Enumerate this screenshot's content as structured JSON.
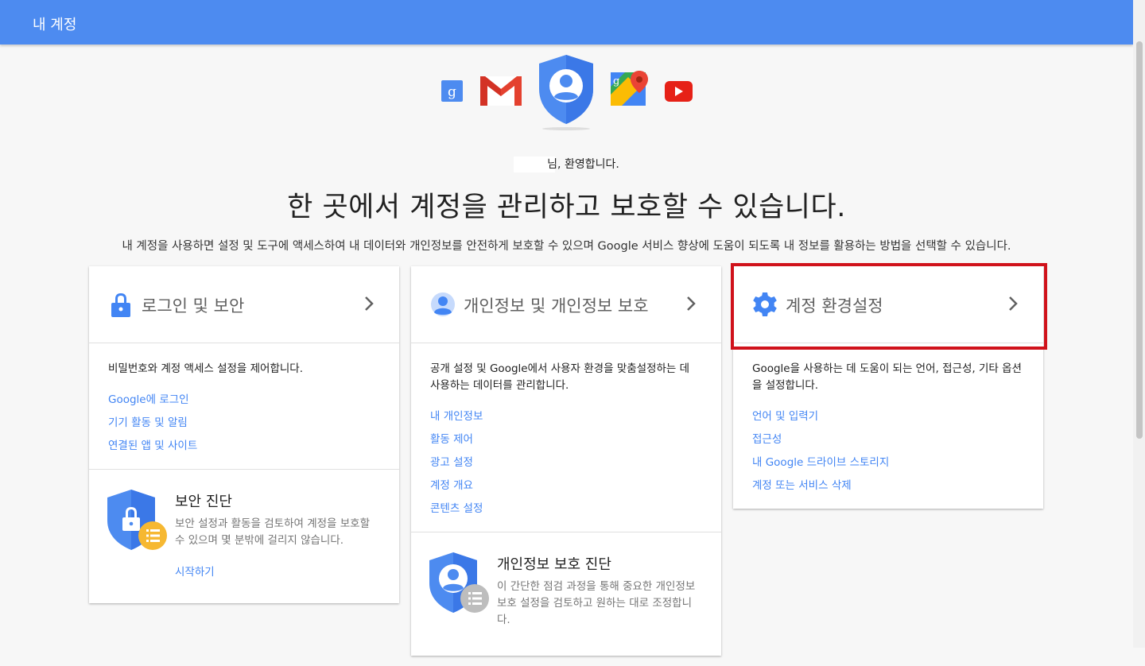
{
  "topbar": {
    "title": "내 계정"
  },
  "welcome": {
    "text": "님, 환영합니다."
  },
  "headline": "한 곳에서 계정을 관리하고 보호할 수 있습니다.",
  "subline": "내 계정을 사용하면 설정 및 도구에 액세스하여 내 데이터와 개인정보를 안전하게 보호할 수 있으며 Google 서비스 향상에 도움이 되도록 내 정보를 활용하는 방법을 선택할 수 있습니다.",
  "cards": [
    {
      "title": "로그인 및 보안",
      "description": "비밀번호와 계정 액세스 설정을 제어합니다.",
      "links": [
        "Google에 로그인",
        "기기 활동 및 알림",
        "연결된 앱 및 사이트"
      ],
      "checkup": {
        "title": "보안 진단",
        "description": "보안 설정과 활동을 검토하여 계정을 보호할 수 있으며 몇 분밖에 걸리지 않습니다.",
        "link": "시작하기"
      }
    },
    {
      "title": "개인정보 및 개인정보 보호",
      "description": "공개 설정 및 Google에서 사용자 환경을 맞춤설정하는 데 사용하는 데이터를 관리합니다.",
      "links": [
        "내 개인정보",
        "활동 제어",
        "광고 설정",
        "계정 개요",
        "콘텐츠 설정"
      ],
      "checkup": {
        "title": "개인정보 보호 진단",
        "description": "이 간단한 점검 과정을 통해 중요한 개인정보 보호 설정을 검토하고 원하는 대로 조정합니다."
      }
    },
    {
      "title": "계정 환경설정",
      "description": "Google을 사용하는 데 도움이 되는 언어, 접근성, 기타 옵션을 설정합니다.",
      "links": [
        "언어 및 입력기",
        "접근성",
        "내 Google 드라이브 스토리지",
        "계정 또는 서비스 삭제"
      ]
    }
  ],
  "icons": [
    "google-plus-icon",
    "gmail-icon",
    "account-shield-icon",
    "maps-icon",
    "youtube-icon",
    "lock-icon",
    "person-icon",
    "gear-icon",
    "chevron-right-icon"
  ],
  "colors": {
    "topbar": "#4d8bf0",
    "link": "#4285f4",
    "highlight": "#d0121b"
  }
}
